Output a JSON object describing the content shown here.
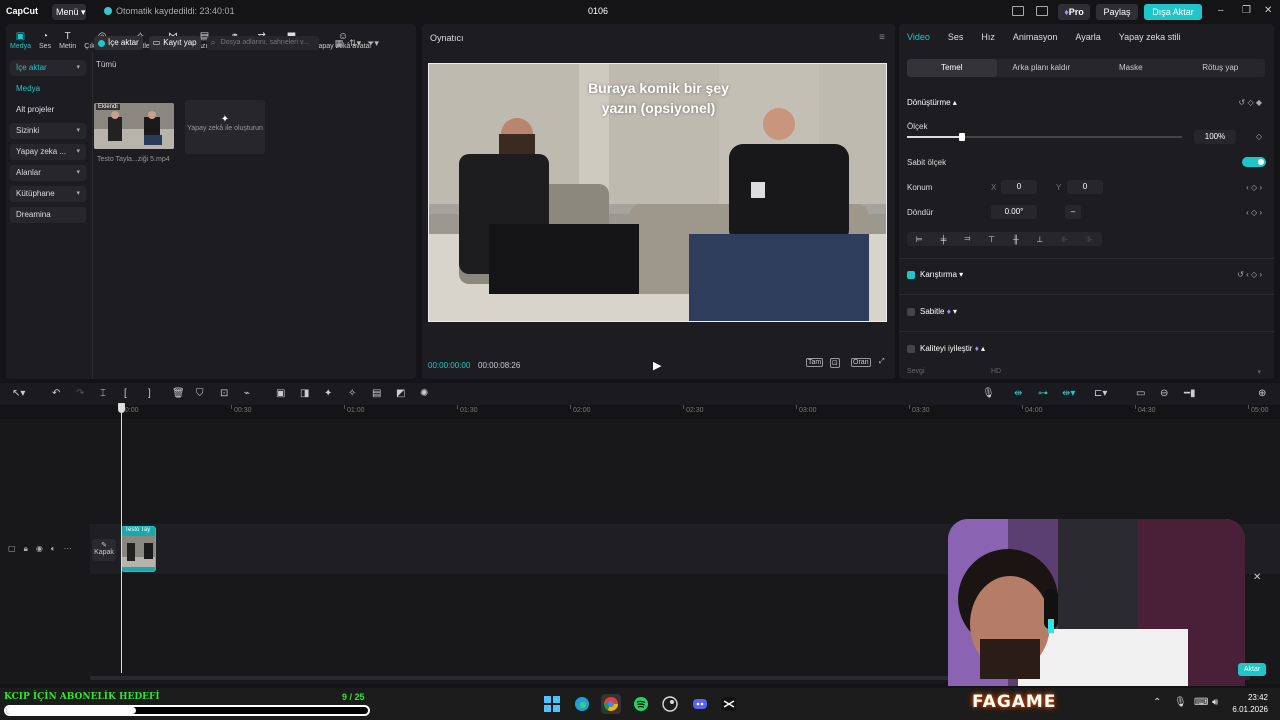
{
  "app": {
    "logo": "CapCut",
    "menu_label": "Menü",
    "autosave_text": "Otomatik kaydedildi: 23:40:01",
    "project_title": "0106",
    "pro_label": "Pro",
    "share_label": "Paylaş",
    "export_label": "Dışa Aktar",
    "accent_color": "#1fc6c9"
  },
  "tool_tabs": [
    {
      "label": "Medya",
      "icon": "media-icon",
      "glyph": "▣"
    },
    {
      "label": "Ses",
      "icon": "audio-icon",
      "glyph": "◔"
    },
    {
      "label": "Metin",
      "icon": "text-icon",
      "glyph": "T"
    },
    {
      "label": "Çıkartmalar",
      "icon": "sticker-icon",
      "glyph": "◎"
    },
    {
      "label": "Efektler",
      "icon": "effects-icon",
      "glyph": "✧"
    },
    {
      "label": "Geçişler",
      "icon": "transitions-icon",
      "glyph": "⋈"
    },
    {
      "label": "Yazılar",
      "icon": "captions-icon",
      "glyph": "▤"
    },
    {
      "label": "Filtreler",
      "icon": "filters-icon",
      "glyph": "⚭"
    },
    {
      "label": "Ayar",
      "icon": "adjust-icon",
      "glyph": "⇄"
    },
    {
      "label": "Şablonlar",
      "icon": "templates-icon",
      "glyph": "⬒"
    },
    {
      "label": "Yapay zekâ avatar",
      "icon": "ai-avatar-icon",
      "glyph": "☺"
    }
  ],
  "side_nav": {
    "import": "İçe aktar",
    "media": "Medya",
    "sub_projects": "Alt projeler",
    "library_sys": "Sizinki",
    "ai": "Yapay zeka ...",
    "spaces": "Alanlar",
    "library": "Kütüphane",
    "dreamina": "Dreamina"
  },
  "media_panel": {
    "import_btn": "İçe aktar",
    "record_btn": "Kayıt yap",
    "search_placeholder": "Dosya adlarını, sahneleri v...",
    "filter_all": "Tümü",
    "clip_badge": "Eklendi",
    "clip_name": "Testo Tayla...ziği 5.mp4",
    "ai_create_label": "Yapay zekâ ile oluşturun"
  },
  "player": {
    "title": "Oynatıcı",
    "overlay_text_line1": "Buraya komik bir şey",
    "overlay_text_line2": "yazın (opsiyonel)",
    "time_current": "00:00:00:00",
    "time_total": "00:00:08:26",
    "ctl_full": "Tam",
    "ctl_ratio": "Oran"
  },
  "right_panel": {
    "tabs": [
      "Video",
      "Ses",
      "Hız",
      "Animasyon",
      "Ayarla",
      "Yapay zeka stili"
    ],
    "sub_tabs": [
      "Temel",
      "Arka planı kaldır",
      "Maske",
      "Rötuş yap"
    ],
    "transform_label": "Dönüştürme",
    "scale_label": "Ölçek",
    "scale_value": "100%",
    "scale_fraction": 0.2,
    "uniform_scale_label": "Sabit ölçek",
    "position_label": "Konum",
    "pos_x_label": "X",
    "pos_x_value": "0",
    "pos_y_label": "Y",
    "pos_y_value": "0",
    "rotate_label": "Döndür",
    "rotate_value": "0.00°",
    "blend_label": "Karıştırma",
    "stabilize_label": "Sabitle",
    "enhance_label": "Kaliteyi iyileştir",
    "select_label": "Sevgi",
    "select_value": "HD"
  },
  "timeline": {
    "ticks": [
      "00:00",
      "00:30",
      "01:00",
      "01:30",
      "02:00",
      "02:30",
      "03:00",
      "03:30",
      "04:00",
      "04:30",
      "05:00"
    ],
    "clip_label": "Testo Tay",
    "cover_label": "Kapak"
  },
  "overlay_webcam": {
    "export_tag": "Aktar"
  },
  "goal": {
    "title": "KCIP İÇİN ABONELİK HEDEFİ",
    "current": 9,
    "target": 25,
    "count_text": "9 / 25"
  },
  "taskbar": {
    "brand": "FAGAME",
    "time": "23:42",
    "date": "6.01.2026",
    "apps": [
      "windows-start-icon",
      "edge-icon",
      "chrome-icon",
      "spotify-icon",
      "steam-icon",
      "discord-icon",
      "capcut-icon"
    ]
  }
}
